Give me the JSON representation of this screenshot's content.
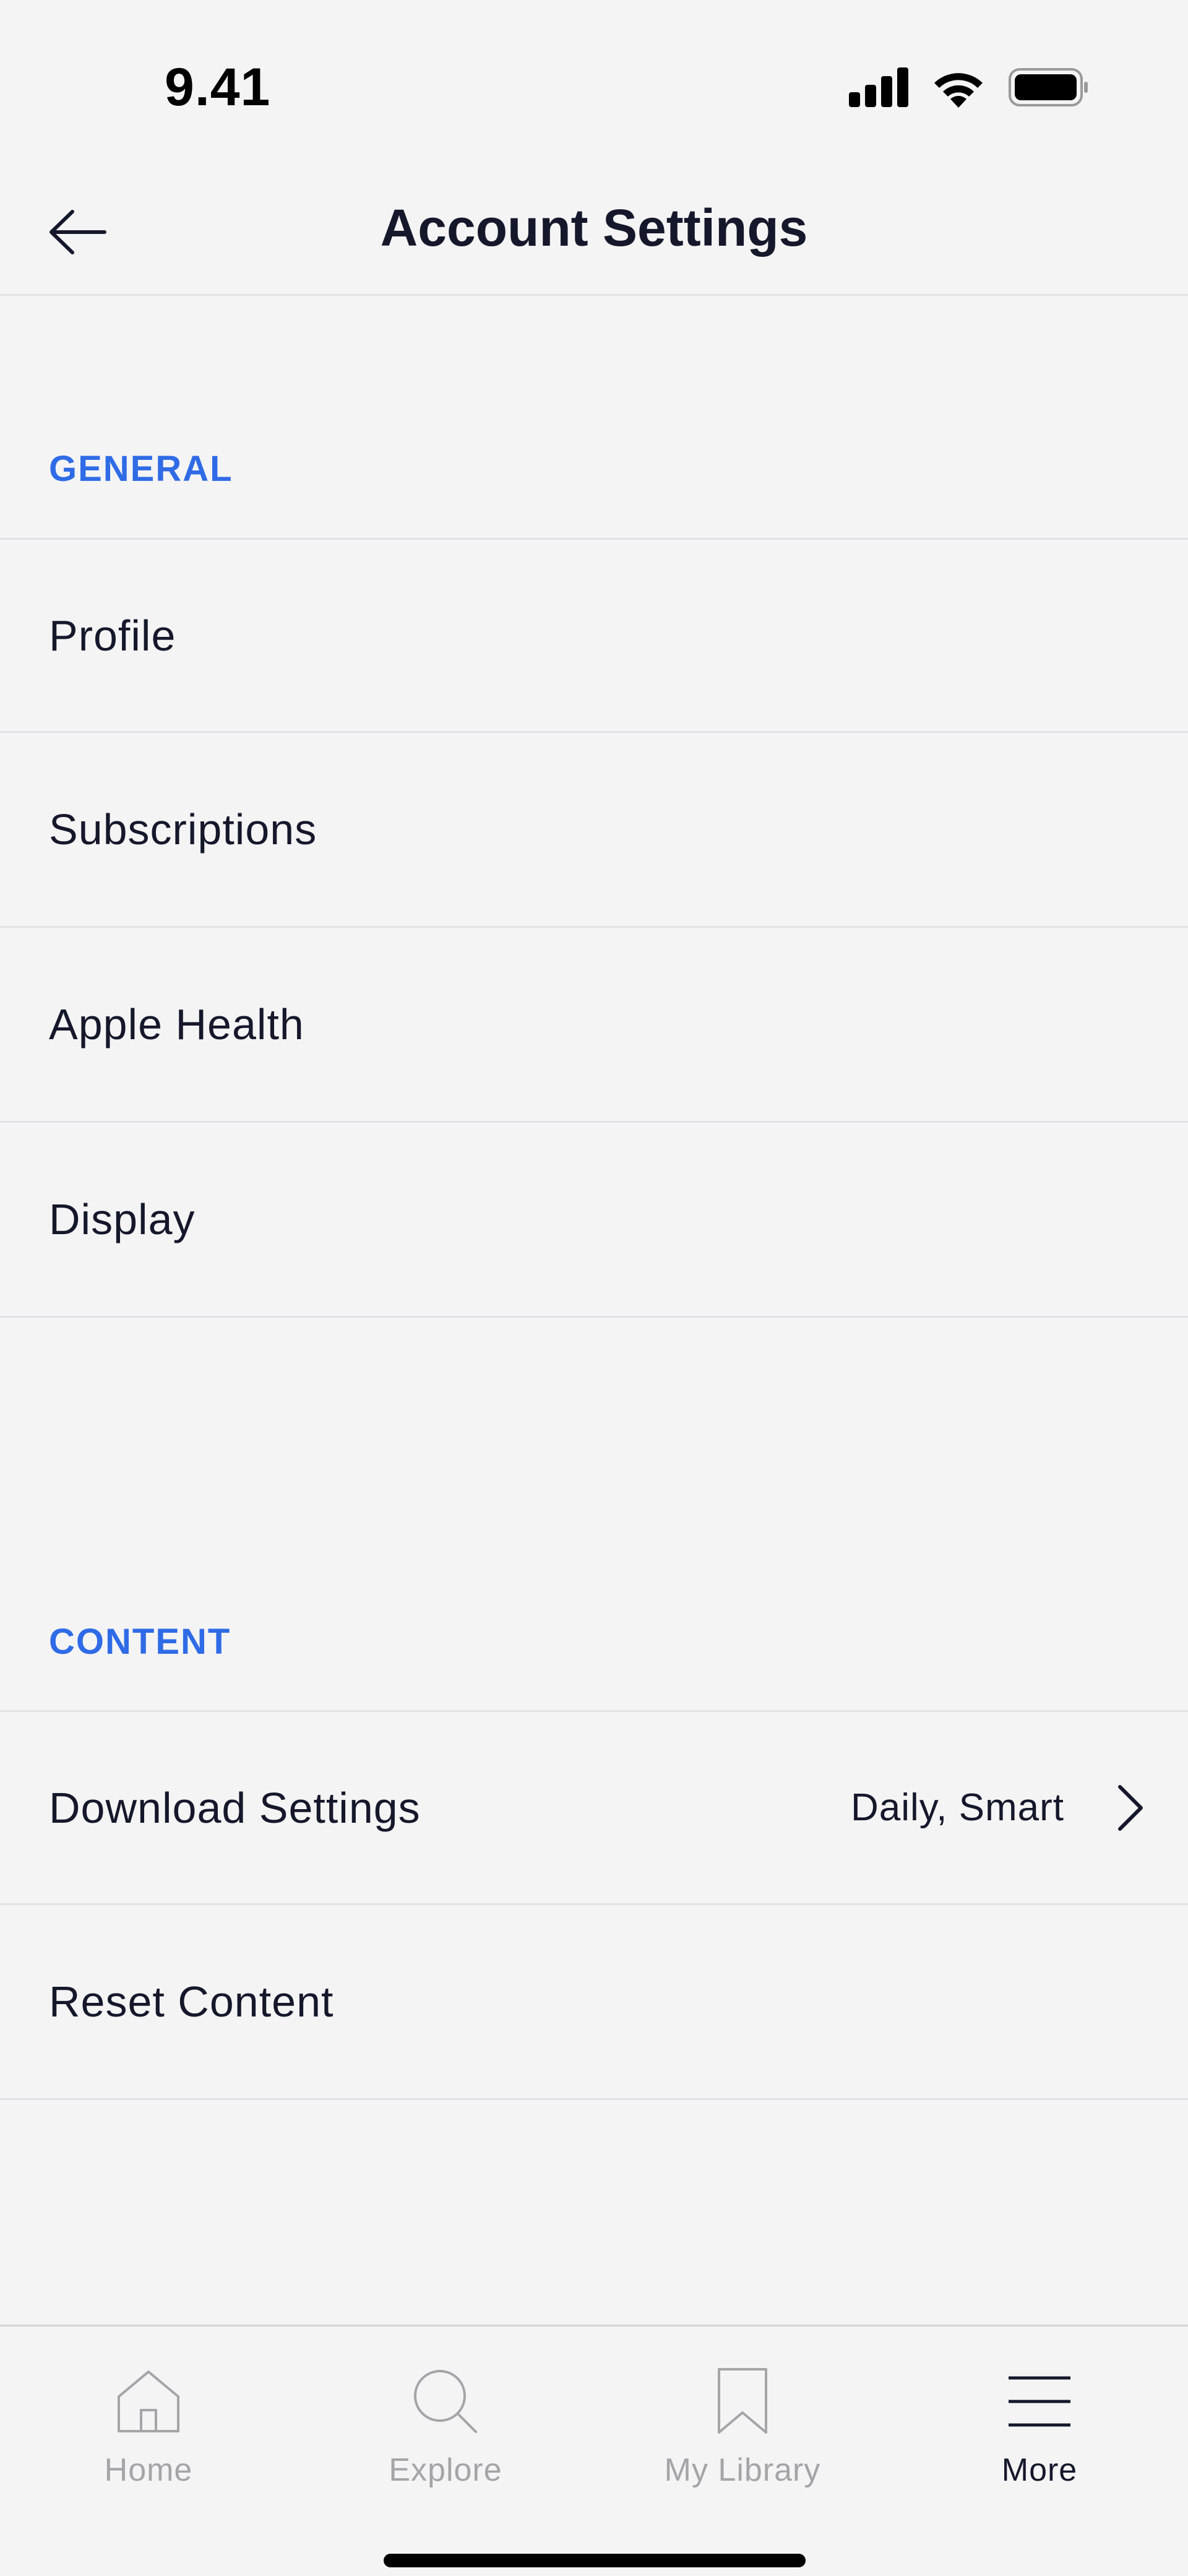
{
  "status_bar": {
    "time": "9.41",
    "signal_icon": "cellular-signal-icon",
    "wifi_icon": "wifi-icon",
    "battery_icon": "battery-icon"
  },
  "header": {
    "title": "Account Settings",
    "back_icon": "arrow-left-icon"
  },
  "sections": {
    "general": {
      "label": "GENERAL",
      "items": [
        {
          "label": "Profile"
        },
        {
          "label": "Subscriptions"
        },
        {
          "label": "Apple Health"
        },
        {
          "label": "Display"
        }
      ]
    },
    "content": {
      "label": "CONTENT",
      "items": [
        {
          "label": "Download Settings",
          "value": "Daily, Smart",
          "icon": "chevron-right-icon"
        },
        {
          "label": "Reset Content"
        }
      ]
    }
  },
  "tab_bar": {
    "tabs": [
      {
        "label": "Home",
        "icon": "home-icon"
      },
      {
        "label": "Explore",
        "icon": "search-icon"
      },
      {
        "label": "My Library",
        "icon": "bookmark-icon"
      },
      {
        "label": "More",
        "icon": "menu-icon"
      }
    ],
    "active_tab": "More"
  },
  "colors": {
    "accent": "#2f6be6",
    "background": "#f4f4f4",
    "text": "#15182b",
    "inactive_tab": "#a5a5a8",
    "divider": "#e2e2e4"
  }
}
